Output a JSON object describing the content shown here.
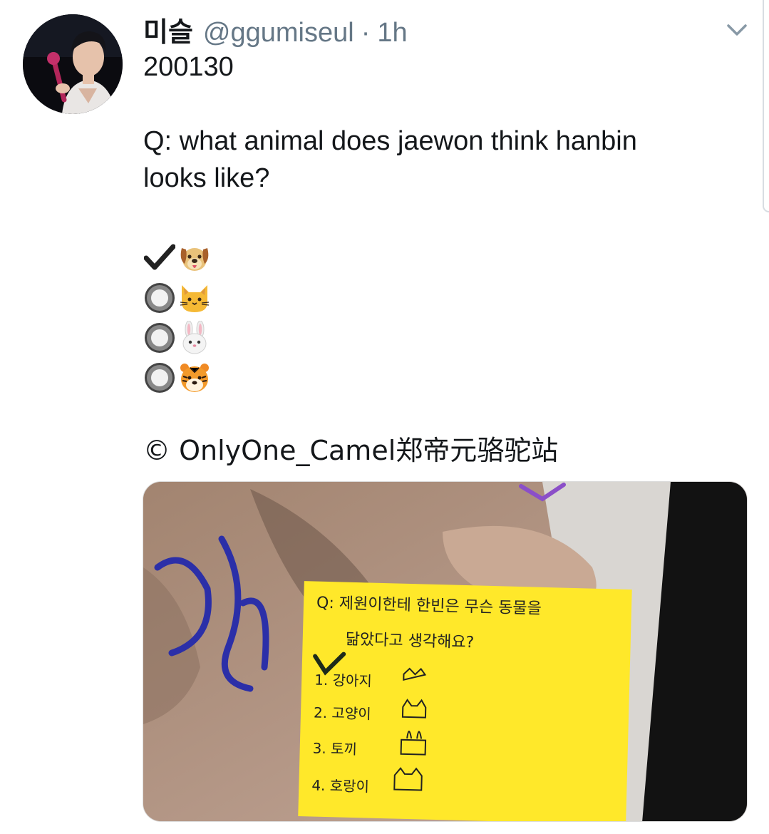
{
  "tweet": {
    "display_name": "미슬",
    "handle": "@ggumiseul",
    "separator": "·",
    "time": "1h",
    "lines": {
      "date": "200130",
      "question_1": "Q: what animal does jaewon think hanbin",
      "question_2": "looks like?"
    },
    "poll": [
      {
        "mark": "check",
        "animal": "dog",
        "selected": true
      },
      {
        "mark": "radio",
        "animal": "cat",
        "selected": false
      },
      {
        "mark": "radio",
        "animal": "rabbit",
        "selected": false
      },
      {
        "mark": "radio",
        "animal": "tiger",
        "selected": false
      }
    ],
    "credit": "© OnlyOne_Camel郑帝元骆驼站"
  },
  "photo_note": {
    "q_line_1": "Q: 제원이한테 한빈은 무슨 동물을",
    "q_line_2": "닮았다고 생각해요?",
    "options": [
      "1. 강아지",
      "2. 고양이",
      "3. 토끼",
      "4. 호랑이"
    ]
  },
  "colors": {
    "text": "#14171a",
    "secondary": "#657786",
    "note_yellow": "#ffe82a"
  },
  "icons": {
    "caret": "chevron-down-icon",
    "check": "heavy-check-mark-icon",
    "radio": "radio-button-icon"
  }
}
